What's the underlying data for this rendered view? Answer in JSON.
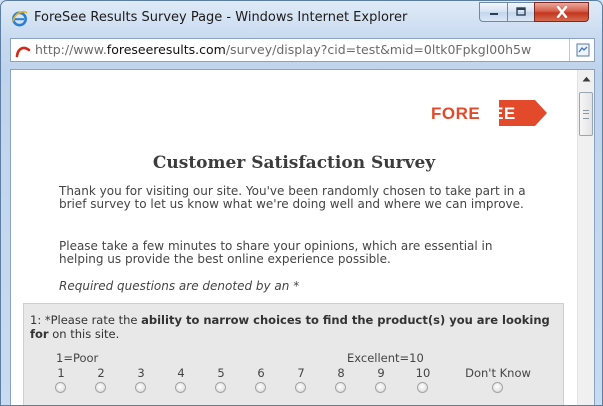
{
  "window": {
    "title": "ForeSee Results Survey Page - Windows Internet Explorer",
    "url_prefix": "http://www.",
    "url_domain": "foreseeresults.com",
    "url_rest": "/survey/display?cid=test&mid=0ltk0Fpkgl00h5w"
  },
  "logo": {
    "text": "FORESEE"
  },
  "survey": {
    "title": "Customer Satisfaction Survey",
    "intro": "Thank you for visiting our site. You've been randomly chosen to take part in a brief survey to let us know what we're doing well and where we can improve.",
    "invite": "Please take a few minutes to share your opinions, which are essential in helping us provide the best online experience possible.",
    "required_note": "Required questions are denoted by an *"
  },
  "question1": {
    "prefix": "1: *Please rate the ",
    "emphasis": "ability to narrow choices to find the product(s) you are looking for",
    "suffix": " on this site.",
    "low_label": "1=Poor",
    "high_label": "Excellent=10",
    "options": [
      "1",
      "2",
      "3",
      "4",
      "5",
      "6",
      "7",
      "8",
      "9",
      "10"
    ],
    "dont_know": "Don't Know"
  }
}
